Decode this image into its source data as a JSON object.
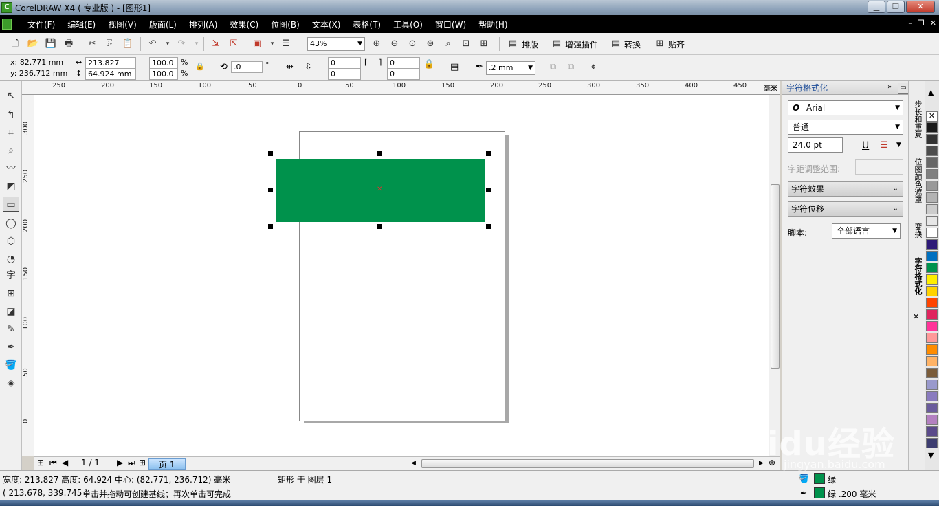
{
  "window": {
    "title": "CorelDRAW X4 ( 专业版 ) - [图形1]"
  },
  "menu": [
    "文件(F)",
    "编辑(E)",
    "视图(V)",
    "版面(L)",
    "排列(A)",
    "效果(C)",
    "位图(B)",
    "文本(X)",
    "表格(T)",
    "工具(O)",
    "窗口(W)",
    "帮助(H)"
  ],
  "toolbar": {
    "zoom": "43%",
    "plugins": [
      "排版",
      "增强插件",
      "转换",
      "贴齐"
    ]
  },
  "property_bar": {
    "x": "x: 82.771 mm",
    "y": "y: 236.712 mm",
    "width": "213.827 mm",
    "height": "64.924 mm",
    "scale_w": "100.0",
    "scale_h": "100.0",
    "percent": "%",
    "rotation": ".0",
    "degree": "°",
    "corner_a": "0",
    "corner_b": "0",
    "corner_c": "0",
    "corner_d": "0",
    "outline_width": ".2 mm"
  },
  "ruler": {
    "top_labels": [
      "250",
      "200",
      "150",
      "100",
      "50",
      "0",
      "50",
      "100",
      "150",
      "200",
      "250",
      "300",
      "350",
      "400",
      "450"
    ],
    "unit": "毫米",
    "left_labels": [
      "300",
      "250",
      "200",
      "150",
      "100",
      "50",
      "0"
    ]
  },
  "page_nav": {
    "position": "1 / 1",
    "tab": "页 1"
  },
  "docker": {
    "title": "字符格式化",
    "font": "Arial",
    "style": "普通",
    "size": "24.0 pt",
    "kerning_label": "字距调整范围:",
    "section1": "字符效果",
    "section2": "字符位移",
    "script_label": "脚本:",
    "script_value": "全部语言"
  },
  "side_tabs": [
    "步长和重复",
    "位图颜色遮罩",
    "变换",
    "字符格式化"
  ],
  "palette": [
    "#ffffff",
    "#1a1a1a",
    "#333333",
    "#4d4d4d",
    "#666666",
    "#808080",
    "#999999",
    "#b3b3b3",
    "#cccccc",
    "#e6e6e6",
    "#ffffff",
    "#2e1a78",
    "#0070c0",
    "#00924c",
    "#ffee00",
    "#ffd200",
    "#ff4500",
    "#e0245e",
    "#ff3399",
    "#ff9999",
    "#ff8c00",
    "#ffb366",
    "#7a5c3a",
    "#9999cc",
    "#8a7bbf",
    "#6a5c9c",
    "#b380c0",
    "#5a4a8a",
    "#3d3d70"
  ],
  "status": {
    "line1": "宽度: 213.827  高度: 64.924  中心: (82.771, 236.712)  毫米",
    "object_info": "矩形 于 图层 1",
    "line2": "( 213.678, 339.745 )",
    "hint": "单击并拖动可创建基线；再次单击可完成",
    "fill_label": "绿",
    "outline_label": "绿  .200 毫米"
  },
  "watermark": {
    "text": "Baidu经验",
    "sub": "jingyan.baidu.com"
  }
}
